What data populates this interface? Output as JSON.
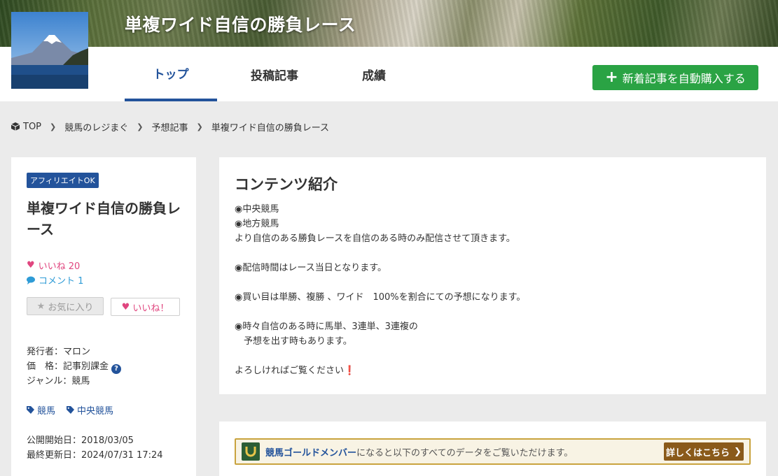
{
  "header": {
    "title": "単複ワイド自信の勝負レース"
  },
  "tabs": [
    {
      "label": "トップ",
      "active": true
    },
    {
      "label": "投稿記事",
      "active": false
    },
    {
      "label": "成績",
      "active": false
    }
  ],
  "buy_button": {
    "icon": "plus-icon",
    "label": "新着記事を自動購入する",
    "color": "#2aa344"
  },
  "breadcrumb": {
    "items": [
      "TOP",
      "競馬のレジまぐ",
      "予想記事",
      "単複ワイド自信の勝負レース"
    ]
  },
  "sidebar": {
    "badge": "アフィリエイトOK",
    "title": "単複ワイド自信の勝負レース",
    "likes_label": "いいね 20",
    "comments_label": "コメント 1",
    "favorite_button": "お気に入り",
    "like_button": "いいね！",
    "publisher": "発行者：マロン",
    "price": "価　格：記事別課金",
    "genre": "ジャンル：競馬",
    "tags": [
      "競馬",
      "中央競馬"
    ],
    "published": "公開開始日：2018/03/05",
    "updated": "最終更新日：2024/07/31 17:24"
  },
  "content": {
    "heading": "コンテンツ紹介",
    "body": "◉中央競馬\n◉地方競馬\nより自信のある勝負レースを自信のある時のみ配信させて頂きます。\n\n◉配信時間はレース当日となります。\n\n◉買い目は単勝、複勝 、ワイド　100%を割合にての予想になります。\n\n◉時々自信のある時に馬単、3連単、3連複の\n　予想を出す時もあります。\n\nよろしければご覧ください",
    "excl": "❗"
  },
  "gold_member": {
    "bold_text": "競馬ゴールドメンバー",
    "text": "になると以下のすべてのデータをご覧いただけます。",
    "button": "詳しくはこちら",
    "accent": "#c9a33e"
  },
  "colors": {
    "brand_blue": "#23539b",
    "like_pink": "#e0467f",
    "comment_blue": "#2e9bd6"
  }
}
